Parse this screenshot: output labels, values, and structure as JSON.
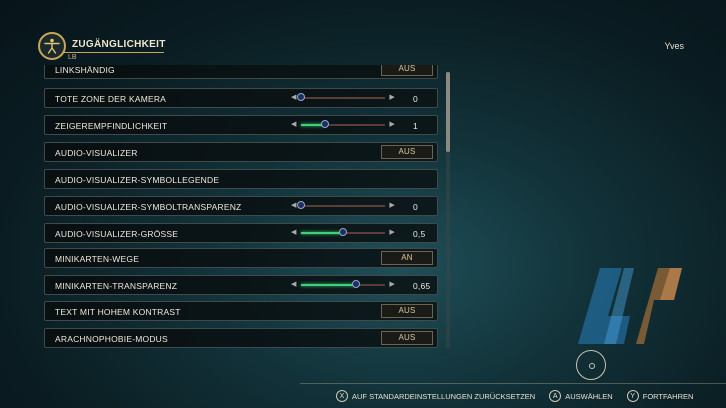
{
  "header": {
    "title": "ZUGÄNGLICHKEIT",
    "badge": "LB",
    "user": "Yves"
  },
  "rows": [
    {
      "label": "LINKSHÄNDIG",
      "value": "AUS"
    },
    {
      "label": "TOTE ZONE DER KAMERA",
      "value": "0",
      "level": 0.0
    },
    {
      "label": "ZEIGEREMPFINDLICHKEIT",
      "value": "1",
      "level": 0.28
    },
    {
      "label": "AUDIO-VISUALIZER",
      "value": "AUS"
    },
    {
      "label": "AUDIO-VISUALIZER-SYMBOLLEGENDE"
    },
    {
      "label": "AUDIO-VISUALIZER-SYMBOLTRANSPARENZ",
      "value": "0",
      "level": 0.0
    },
    {
      "label": "AUDIO-VISUALIZER-GRÖSSE",
      "value": "0,5",
      "level": 0.5
    },
    {
      "label": "MINIKARTEN-WEGE",
      "value": "AN"
    },
    {
      "label": "MINIKARTEN-TRANSPARENZ",
      "value": "0,65",
      "level": 0.65
    },
    {
      "label": "TEXT MIT HOHEM KONTRAST",
      "value": "AUS"
    },
    {
      "label": "ARACHNOPHOBIE-MODUS",
      "value": "AUS"
    }
  ],
  "footer": {
    "reset": {
      "button": "X",
      "label": "AUF STANDARDEINSTELLUNGEN ZURÜCKSETZEN"
    },
    "select": {
      "button": "A",
      "label": "AUSWÄHLEN"
    },
    "continue": {
      "button": "Y",
      "label": "FORTFAHREN"
    }
  },
  "colors": {
    "accent_gold": "#c9a55a",
    "slider_fill": "#3fd07a"
  }
}
